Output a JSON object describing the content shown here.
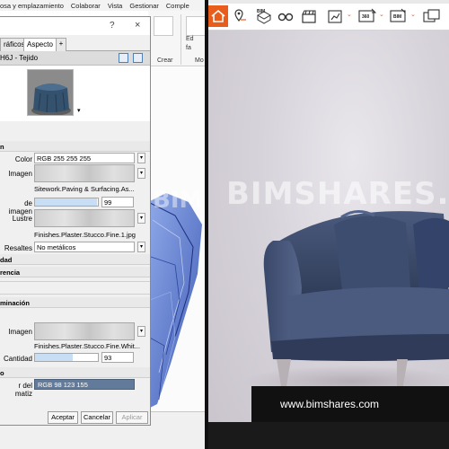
{
  "menubar": {
    "items": [
      "osa y emplazamiento",
      "Colaborar",
      "Vista",
      "Gestionar",
      "Comple"
    ]
  },
  "ribbon": {
    "crear_label": "Crear",
    "mo_label": "Mo",
    "ed_label": "Ed",
    "fa_label": "fa"
  },
  "dialog": {
    "help": "?",
    "close": "×",
    "tabs": [
      "ráficos",
      "Aspecto",
      "+"
    ],
    "asset_name": "H6J - Tejido",
    "sections": {
      "general": "n",
      "altura": "dad",
      "transparencia": "rencia",
      "iluminacion": "minación",
      "tint": "o"
    },
    "props": {
      "color_label": "Color",
      "color_value": "RGB 255 255 255",
      "imagen_label": "Imagen",
      "imagen_texture": "Sitework.Paving & Surfacing.As...",
      "fade_label": "de imagen",
      "fade_value": "99",
      "lustre_label": "Lustre",
      "lustre_texture": "Finishes.Plaster.Stucco.Fine.1.jpg",
      "resaltes_label": "Resaltes",
      "resaltes_value": "No metálicos",
      "imagen2_label": "Imagen",
      "imagen2_texture": "Finishes.Plaster.Stucco.Fine.Whit...",
      "cantidad_label": "Cantidad",
      "cantidad_value": "93",
      "matiz_label": "r del matiz",
      "matiz_value": "RGB 98 123 155"
    },
    "buttons": {
      "accept": "Aceptar",
      "cancel": "Cancelar",
      "apply": "Aplicar"
    }
  },
  "viewer": {
    "toolbar": {
      "labels": [
        "BIM",
        "360",
        "BIM"
      ]
    },
    "watermark": "BIMSHARES.COM",
    "watermark_left": "BIMSHA",
    "footer": "www.bimshares.com"
  },
  "colors": {
    "accent": "#e95d1c",
    "tint": "#627b9b",
    "chair": "#3a4a6b"
  },
  "icons": [
    "home-icon",
    "map-pin-icon",
    "bim-icon",
    "vr-glasses-icon",
    "clapper-icon",
    "chart-icon",
    "360-icon",
    "bim-export-icon"
  ]
}
